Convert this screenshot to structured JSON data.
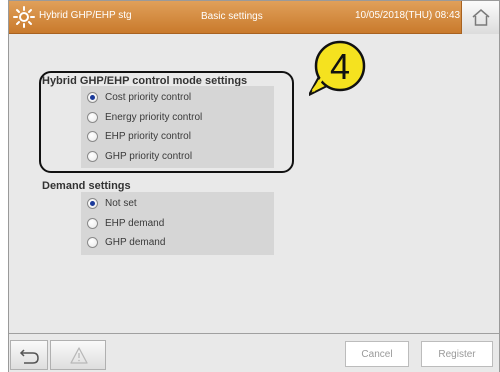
{
  "header": {
    "app_title": "Hybrid GHP/EHP stg",
    "screen_title": "Basic settings",
    "datetime": "10/05/2018(THU) 08:43",
    "accent_color": "#d38a3c",
    "app_icon": "sun-icon",
    "home_icon": "home-icon"
  },
  "control_mode": {
    "title": "Hybrid GHP/EHP control mode settings",
    "selected": "Cost priority control",
    "options": [
      "Cost priority control",
      "Energy priority control",
      "EHP priority control",
      "GHP priority control"
    ]
  },
  "demand": {
    "title": "Demand settings",
    "selected": "Not set",
    "options": [
      "Not set",
      "EHP demand",
      "GHP demand"
    ]
  },
  "callout": {
    "number": "4"
  },
  "footer": {
    "back_icon": "back-arrow-icon",
    "warning_icon": "warning-icon",
    "cancel_label": "Cancel",
    "register_label": "Register"
  }
}
